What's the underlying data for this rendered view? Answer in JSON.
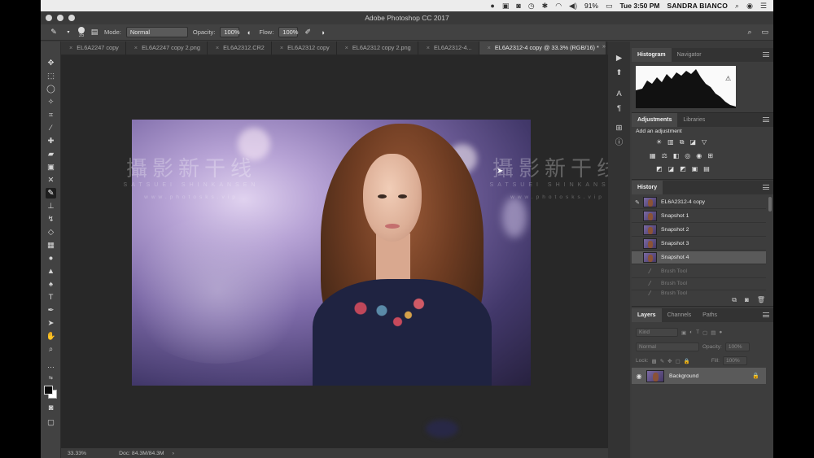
{
  "menubar": {
    "time": "Tue 3:50 PM",
    "user": "SANDRA BIANCO",
    "battery": "91%"
  },
  "window": {
    "title": "Adobe Photoshop CC 2017"
  },
  "options": {
    "brush_size": "35",
    "mode_label": "Mode:",
    "mode_value": "Normal",
    "opacity_label": "Opacity:",
    "opacity_value": "100%",
    "flow_label": "Flow:",
    "flow_value": "100%"
  },
  "tabs": [
    {
      "label": "EL6A2247 copy"
    },
    {
      "label": "EL6A2247 copy 2.png"
    },
    {
      "label": "EL6A2312.CR2"
    },
    {
      "label": "EL6A2312 copy"
    },
    {
      "label": "EL6A2312 copy 2.png"
    },
    {
      "label": "EL6A2312-4..."
    },
    {
      "label": "EL6A2312-4 copy @ 33.3% (RGB/16) *"
    }
  ],
  "watermark": {
    "big": "攝影新干线",
    "mid": "SATSUEI SHINKANSEN",
    "small": "www.photosks.vip"
  },
  "status": {
    "zoom": "33.33%",
    "doc": "Doc: 84.3M/84.3M"
  },
  "panels": {
    "histogram": {
      "tab1": "Histogram",
      "tab2": "Navigator"
    },
    "adjustments": {
      "tab1": "Adjustments",
      "tab2": "Libraries",
      "title": "Add an adjustment"
    },
    "history": {
      "tab": "History",
      "items": [
        {
          "label": "EL6A2312-4 copy"
        },
        {
          "label": "Snapshot 1"
        },
        {
          "label": "Snapshot 2"
        },
        {
          "label": "Snapshot 3"
        },
        {
          "label": "Snapshot 4"
        }
      ],
      "steps": [
        {
          "label": "Brush Tool"
        },
        {
          "label": "Brush Tool"
        },
        {
          "label": "Brush Tool"
        }
      ]
    },
    "layers": {
      "tab1": "Layers",
      "tab2": "Channels",
      "tab3": "Paths",
      "kind": "Kind",
      "blend": "Normal",
      "opacity_label": "Opacity:",
      "opacity_value": "100%",
      "lock_label": "Lock:",
      "fill_label": "Fill:",
      "fill_value": "100%",
      "layer_name": "Background"
    }
  },
  "colors": {
    "accent": "#474747",
    "selected": "#5a5a5a",
    "panel_bg": "#3d3d3d"
  }
}
